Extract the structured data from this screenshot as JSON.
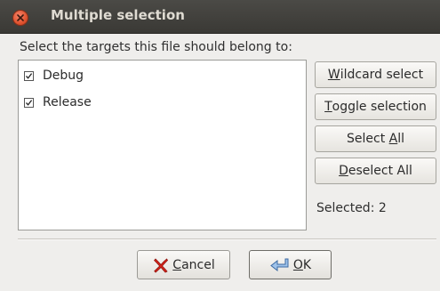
{
  "window": {
    "title": "Multiple selection"
  },
  "prompt": "Select the targets this file should belong to:",
  "targets": [
    {
      "label": "Debug",
      "checked": true
    },
    {
      "label": "Release",
      "checked": true
    }
  ],
  "buttons": {
    "wildcard": {
      "mnemonic": "W",
      "rest": "ildcard select"
    },
    "toggle": {
      "mnemonic": "T",
      "rest": "oggle selection"
    },
    "select_all": {
      "before": "Select ",
      "mnemonic": "A",
      "rest": "ll"
    },
    "deselect_all": {
      "mnemonic": "D",
      "rest": "eselect All"
    },
    "cancel": {
      "mnemonic": "C",
      "rest": "ancel"
    },
    "ok": {
      "mnemonic": "O",
      "rest": "K"
    }
  },
  "status": {
    "selected": "Selected: 2"
  },
  "icons": {
    "close": "close-icon",
    "cancel": "red-x-icon",
    "ok": "enter-arrow-icon"
  },
  "colors": {
    "titlebar": "#3c3b37",
    "close_button": "#e0532f",
    "background": "#efeeec"
  }
}
